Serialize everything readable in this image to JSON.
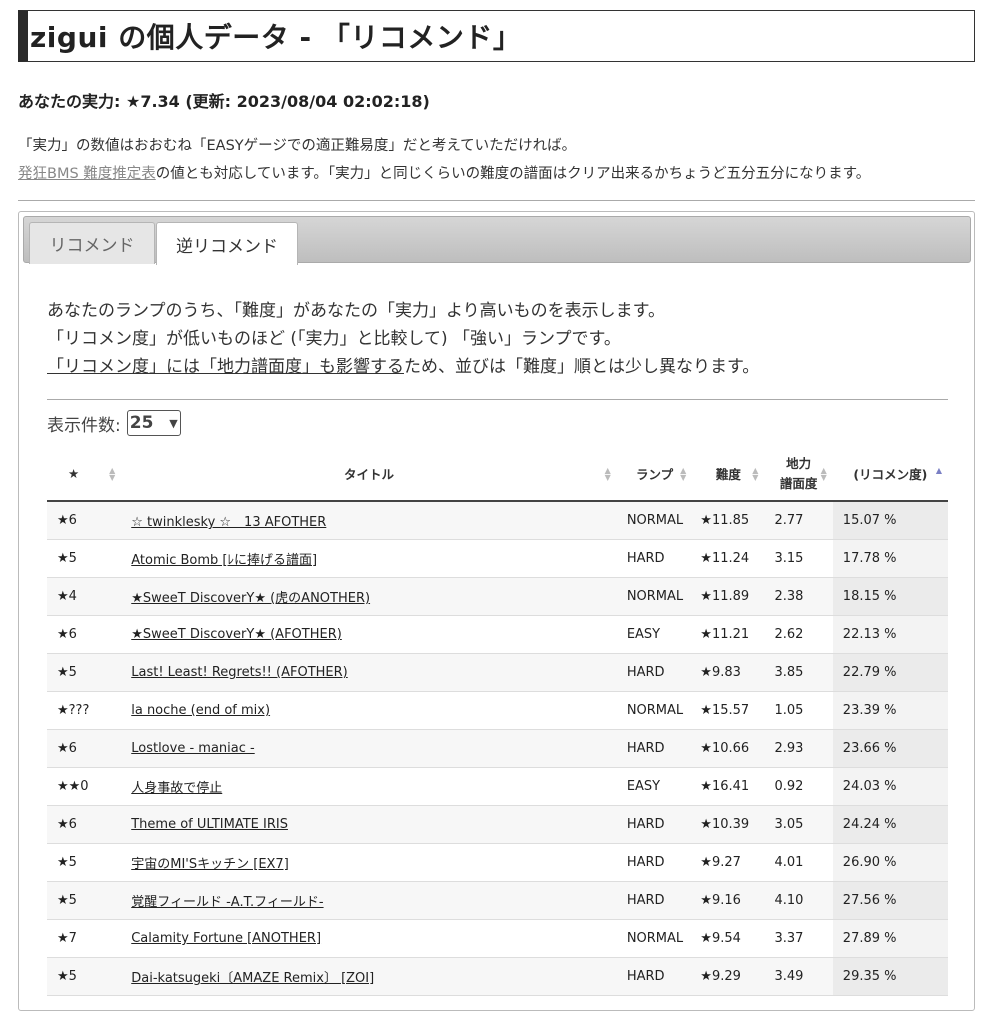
{
  "page": {
    "title": "zigui の個人データ - 「リコメンド」",
    "strength": "あなたの実力: ★7.34 (更新: 2023/08/04 02:02:18)",
    "desc_line1": "「実力」の数値はおおむね「EASYゲージでの適正難易度」だと考えていただければ。",
    "desc_link": "発狂BMS 難度推定表",
    "desc_line2_rest": "の値とも対応しています。「実力」と同じくらいの難度の譜面はクリア出来るかちょうど五分五分になります。"
  },
  "tabs": [
    {
      "label": "リコメンド",
      "active": false
    },
    {
      "label": "逆リコメンド",
      "active": true
    }
  ],
  "intro": {
    "line1": "あなたのランプのうち、「難度」があなたの「実力」より高いものを表示します。",
    "line2": "「リコメン度」が低いものほど (「実力」と比較して) 「強い」ランプです。",
    "line3_ul": "「リコメン度」には「地力譜面度」も影響する",
    "line3_rest": "ため、並びは「難度」順とは少し異なります。"
  },
  "count": {
    "label": "表示件数:",
    "value": "25"
  },
  "headers": {
    "star": "★",
    "title": "タイトル",
    "lamp": "ランプ",
    "difficulty": "難度",
    "chiriki_1": "地力",
    "chiriki_2": "譜面度",
    "recommend": "(リコメン度)"
  },
  "rows": [
    {
      "star": "★6",
      "title": "☆ twinklesky ☆　13 AFOTHER",
      "lamp": "NORMAL",
      "diff": "★11.85",
      "chiriki": "2.77",
      "rec": "15.07 %"
    },
    {
      "star": "★5",
      "title": "Atomic Bomb [ﾚに捧げる譜面]",
      "lamp": "HARD",
      "diff": "★11.24",
      "chiriki": "3.15",
      "rec": "17.78 %"
    },
    {
      "star": "★4",
      "title": "★SweeT DiscoverY★ (虎のANOTHER)",
      "lamp": "NORMAL",
      "diff": "★11.89",
      "chiriki": "2.38",
      "rec": "18.15 %"
    },
    {
      "star": "★6",
      "title": "★SweeT DiscoverY★ (AFOTHER)",
      "lamp": "EASY",
      "diff": "★11.21",
      "chiriki": "2.62",
      "rec": "22.13 %"
    },
    {
      "star": "★5",
      "title": "Last! Least! Regrets!! (AFOTHER)",
      "lamp": "HARD",
      "diff": "★9.83",
      "chiriki": "3.85",
      "rec": "22.79 %"
    },
    {
      "star": "★???",
      "title": "la noche (end of mix)",
      "lamp": "NORMAL",
      "diff": "★15.57",
      "chiriki": "1.05",
      "rec": "23.39 %"
    },
    {
      "star": "★6",
      "title": "Lostlove - maniac -",
      "lamp": "HARD",
      "diff": "★10.66",
      "chiriki": "2.93",
      "rec": "23.66 %"
    },
    {
      "star": "★★0",
      "title": "人身事故で停止",
      "lamp": "EASY",
      "diff": "★16.41",
      "chiriki": "0.92",
      "rec": "24.03 %"
    },
    {
      "star": "★6",
      "title": "Theme of ULTIMATE IRIS",
      "lamp": "HARD",
      "diff": "★10.39",
      "chiriki": "3.05",
      "rec": "24.24 %"
    },
    {
      "star": "★5",
      "title": "宇宙のMI'Sキッチン [EX7]",
      "lamp": "HARD",
      "diff": "★9.27",
      "chiriki": "4.01",
      "rec": "26.90 %"
    },
    {
      "star": "★5",
      "title": "覚醒フィールド -A.T.フィールド-",
      "lamp": "HARD",
      "diff": "★9.16",
      "chiriki": "4.10",
      "rec": "27.56 %"
    },
    {
      "star": "★7",
      "title": "Calamity Fortune [ANOTHER]",
      "lamp": "NORMAL",
      "diff": "★9.54",
      "chiriki": "3.37",
      "rec": "27.89 %"
    },
    {
      "star": "★5",
      "title": "Dai-katsugeki〔AMAZE Remix〕 [ZOI]",
      "lamp": "HARD",
      "diff": "★9.29",
      "chiriki": "3.49",
      "rec": "29.35 %"
    }
  ]
}
